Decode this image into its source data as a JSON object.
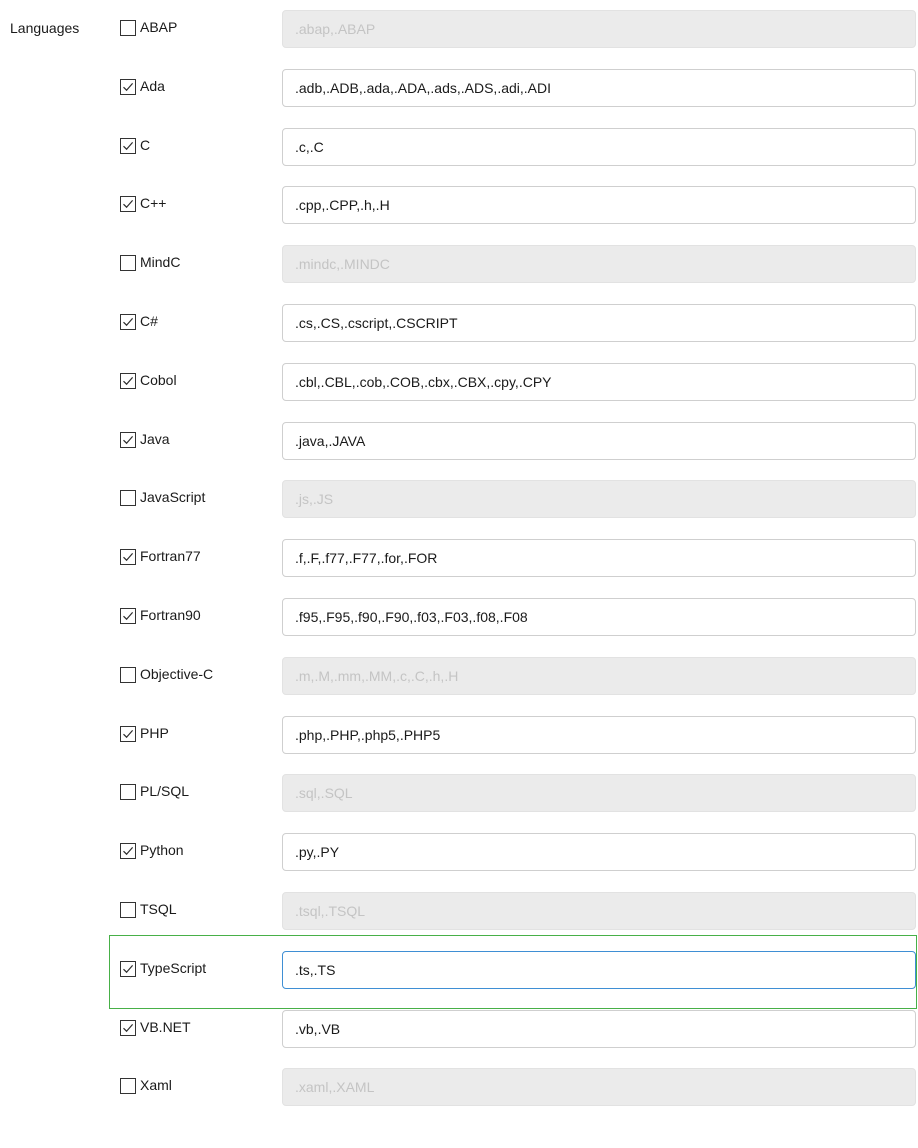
{
  "section_label": "Languages",
  "languages": [
    {
      "name": "ABAP",
      "checked": false,
      "extensions": ".abap,.ABAP"
    },
    {
      "name": "Ada",
      "checked": true,
      "extensions": ".adb,.ADB,.ada,.ADA,.ads,.ADS,.adi,.ADI"
    },
    {
      "name": "C",
      "checked": true,
      "extensions": ".c,.C"
    },
    {
      "name": "C++",
      "checked": true,
      "extensions": ".cpp,.CPP,.h,.H"
    },
    {
      "name": "MindC",
      "checked": false,
      "extensions": ".mindc,.MINDC"
    },
    {
      "name": "C#",
      "checked": true,
      "extensions": ".cs,.CS,.cscript,.CSCRIPT"
    },
    {
      "name": "Cobol",
      "checked": true,
      "extensions": ".cbl,.CBL,.cob,.COB,.cbx,.CBX,.cpy,.CPY"
    },
    {
      "name": "Java",
      "checked": true,
      "extensions": ".java,.JAVA"
    },
    {
      "name": "JavaScript",
      "checked": false,
      "extensions": ".js,.JS"
    },
    {
      "name": "Fortran77",
      "checked": true,
      "extensions": ".f,.F,.f77,.F77,.for,.FOR"
    },
    {
      "name": "Fortran90",
      "checked": true,
      "extensions": ".f95,.F95,.f90,.F90,.f03,.F03,.f08,.F08"
    },
    {
      "name": "Objective-C",
      "checked": false,
      "extensions": ".m,.M,.mm,.MM,.c,.C,.h,.H"
    },
    {
      "name": "PHP",
      "checked": true,
      "extensions": ".php,.PHP,.php5,.PHP5"
    },
    {
      "name": "PL/SQL",
      "checked": false,
      "extensions": ".sql,.SQL"
    },
    {
      "name": "Python",
      "checked": true,
      "extensions": ".py,.PY"
    },
    {
      "name": "TSQL",
      "checked": false,
      "extensions": ".tsql,.TSQL"
    },
    {
      "name": "TypeScript",
      "checked": true,
      "extensions": ".ts,.TS",
      "focused": true
    },
    {
      "name": "VB.NET",
      "checked": true,
      "extensions": ".vb,.VB"
    },
    {
      "name": "Xaml",
      "checked": false,
      "extensions": ".xaml,.XAML"
    }
  ],
  "colors": {
    "focus_frame": "#47b047",
    "focus_input_border": "#3f8fd4",
    "disabled_input_bg": "#ebebeb",
    "disabled_text": "#c4c4c4"
  }
}
